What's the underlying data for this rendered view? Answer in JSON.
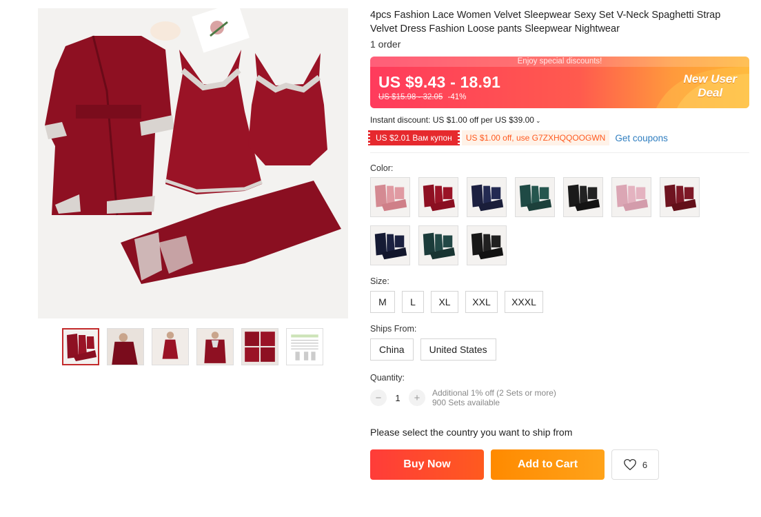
{
  "product": {
    "title": "4pcs Fashion Lace Women Velvet Sleepwear Sexy Set V-Neck Spaghetti Strap Velvet Dress Fashion Loose pants Sleepwear Nightwear",
    "orders": "1 order"
  },
  "price": {
    "banner_top": "Enjoy special discounts!",
    "current": "US $9.43 - 18.91",
    "original": "US $15.98 - 32.05",
    "discount_pct": "-41%",
    "deal_line1": "New User",
    "deal_line2": "Deal"
  },
  "promo": {
    "instant": "Instant discount: US $1.00 off per US $39.00",
    "coupon_red": "US $2.01 Вам купон",
    "coupon_orange": "US $1.00 off, use G7ZXHQQOOGWN",
    "get_coupons": "Get coupons"
  },
  "color": {
    "label": "Color:"
  },
  "size": {
    "label": "Size:",
    "options": [
      "M",
      "L",
      "XL",
      "XXL",
      "XXXL"
    ]
  },
  "ships": {
    "label": "Ships From:",
    "options": [
      "China",
      "United States"
    ]
  },
  "quantity": {
    "label": "Quantity:",
    "minus": "−",
    "plus": "+",
    "value": "1",
    "note1": "Additional 1% off (2 Sets or more)",
    "note2": "900 Sets available"
  },
  "ship_message": "Please select the country you want to ship from",
  "actions": {
    "buy_now": "Buy Now",
    "add_to_cart": "Add to Cart",
    "wishlist_count": "6"
  },
  "colors_theme": {
    "accent_red": "#ff3c39",
    "accent_orange": "#ff8a00",
    "velvet_wine": "#8e1022"
  }
}
